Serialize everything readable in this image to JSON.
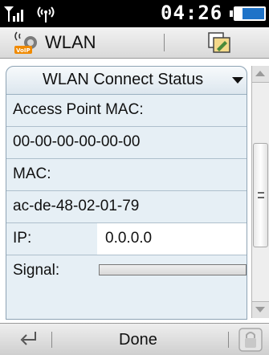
{
  "statusbar": {
    "time": "04:26",
    "icons": [
      "signal-icon",
      "wifi-antenna-icon",
      "battery-icon"
    ]
  },
  "titlebar": {
    "title": "WLAN",
    "icons": [
      "voip-icon",
      "edit-icon"
    ]
  },
  "dropdown": {
    "selected": "WLAN Connect Status"
  },
  "rows": {
    "ap_mac_label": "Access Point MAC:",
    "ap_mac_value": "00-00-00-00-00-00",
    "mac_label": "MAC:",
    "mac_value": "ac-de-48-02-01-79",
    "ip_label": "IP:",
    "ip_value": "0.0.0.0",
    "signal_label": "Signal:",
    "signal_level": 0
  },
  "softkeys": {
    "center_label": "Done",
    "icons": [
      "back-icon",
      "lock-icon"
    ]
  },
  "colors": {
    "panel_bg": "#e6eff5",
    "statusbar_bg": "#000000",
    "battery": "#1e73c8"
  }
}
